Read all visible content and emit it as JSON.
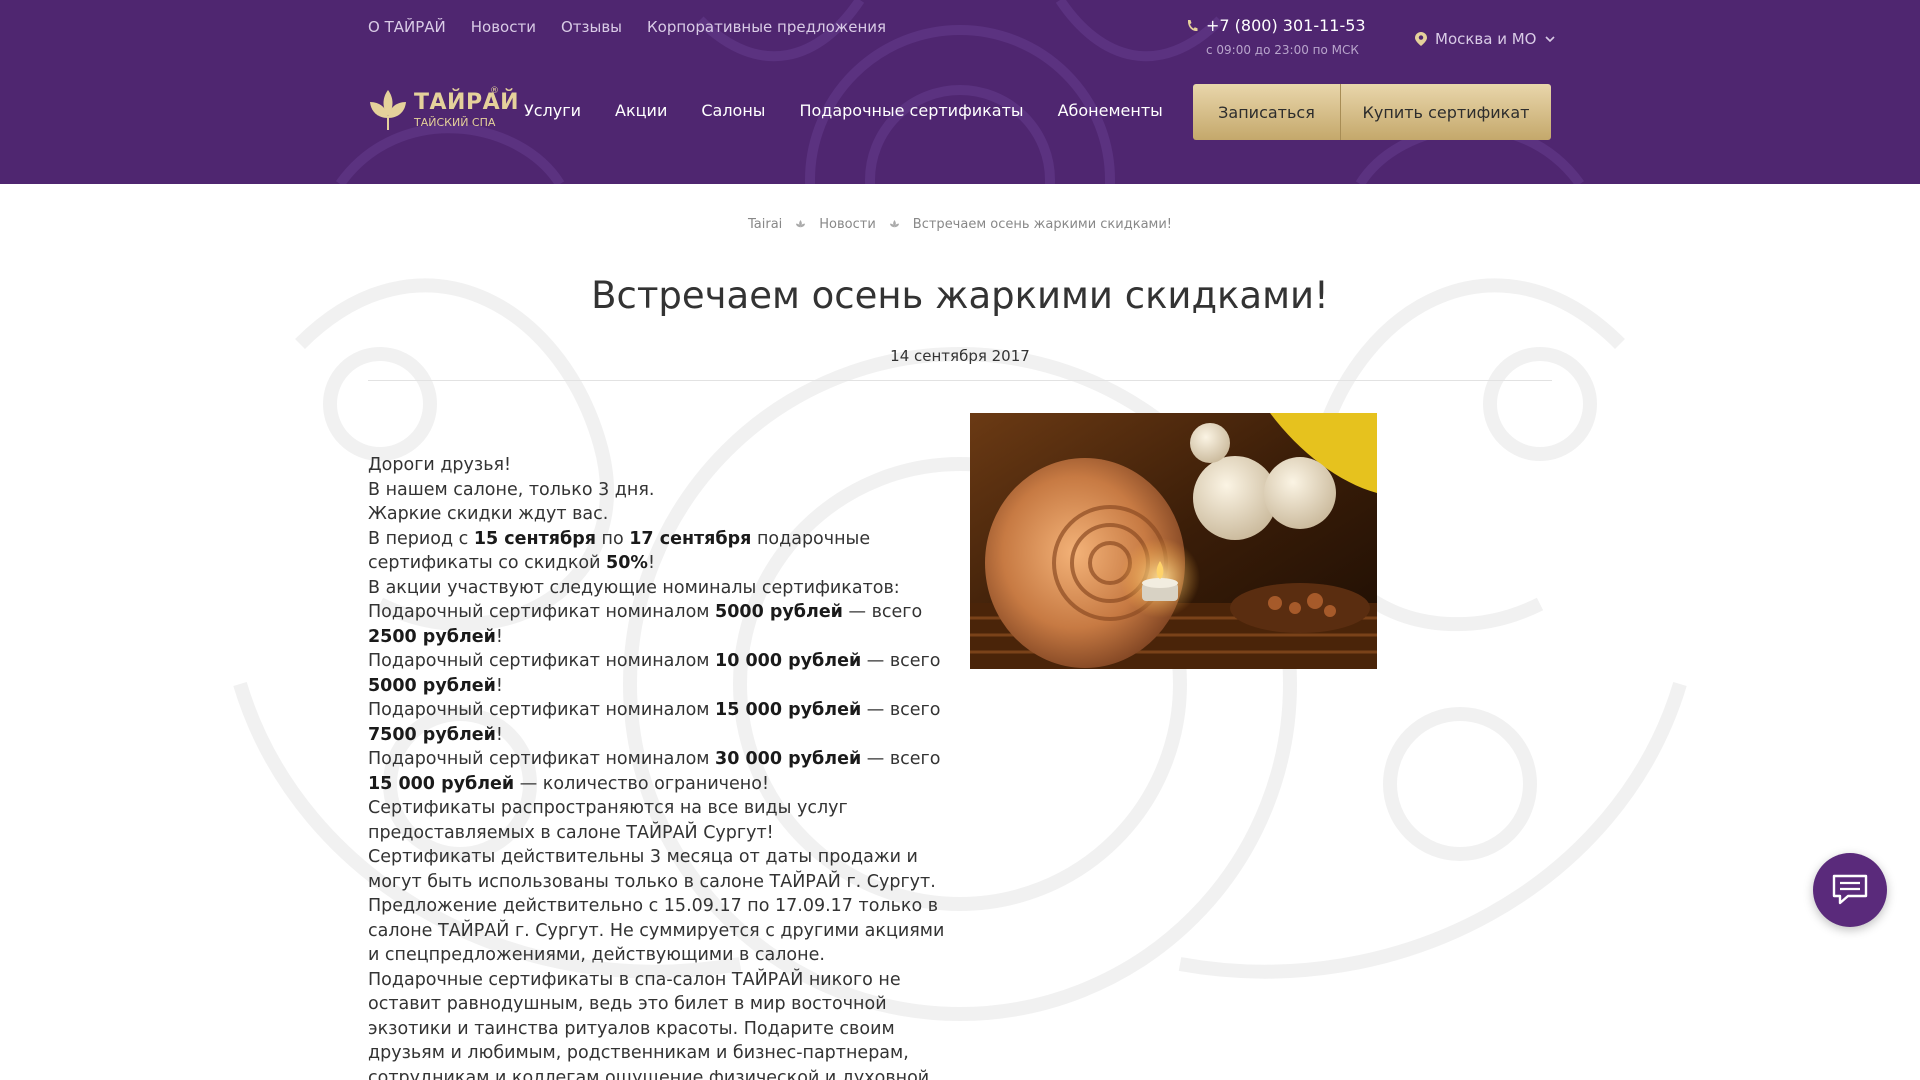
{
  "header": {
    "top_links": [
      "О ТАЙРАЙ",
      "Новости",
      "Отзывы",
      "Корпоративные предложения"
    ],
    "phone": "+7 (800) 301-11-53",
    "hours": "с 09:00 до 23:00 по МСК",
    "city": "Москва и МО",
    "logo_name": "ТАЙРАЙ",
    "logo_sub": "ТАЙСКИЙ СПА",
    "logo_reg": "®",
    "nav": [
      "Услуги",
      "Акции",
      "Салоны",
      "Подарочные сертификаты",
      "Абонементы"
    ],
    "btn_book": "Записаться",
    "btn_buy": "Купить сертификат"
  },
  "breadcrumb": [
    "Tairai",
    "Новости",
    "Встречаем осень жаркими скидками!"
  ],
  "title": "Встречаем осень жаркими скидками!",
  "date": "14 сентября 2017",
  "article": {
    "l1": "Дороги друзья!",
    "l2": "В нашем салоне, только 3 дня.",
    "l3": "Жаркие скидки ждут вас.",
    "p4a": "В период с ",
    "p4b": "15 сентября",
    "p4c": " по ",
    "p4d": "17 сентября",
    "p4e": " подарочные сертификаты со скидкой ",
    "p4f": "50%",
    "p4g": "!",
    "l5": "В акции участвуют следующие номиналы сертификатов:",
    "cert_prefix": "Подарочный сертификат номиналом ",
    "cert_mid": " — всего ",
    "certs": [
      {
        "nominal": "5000 рублей",
        "price": "2500 рублей",
        "suffix": "!"
      },
      {
        "nominal": "10 000 рублей",
        "price": "5000 рублей",
        "suffix": "!"
      },
      {
        "nominal": "15 000 рублей",
        "price": "7500 рублей",
        "suffix": "!"
      },
      {
        "nominal": "30 000 рублей",
        "price": "15 000 рублей",
        "suffix": " — количество ограничено!"
      }
    ],
    "l6": "Сертификаты распространяются на все виды услуг предоставляемых в салоне ТАЙРАЙ Сургут!",
    "l7": "Сертификаты действительны 3 месяца от даты продажи и могут быть использованы только в салоне ТАЙРАЙ г. Сургут.",
    "l8": "Предложение действительно с 15.09.17 по 17.09.17 только в салоне ТАЙРАЙ г. Сургут. Не суммируется с другими акциями и спецпредложениями, действующими в салоне.",
    "l9": "Подарочные сертификаты в спа-салон ТАЙРАЙ никого не оставит равнодушным, ведь это билет в мир восточной экзотики и таинства ритуалов красоты. Подарите своим друзьям и любимым, родственникам и бизнес-партнерам, сотрудникам и коллегам ощущение физической и духовной гармонии. Будьте уверены"
  },
  "colors": {
    "header_bg": "#4f2670",
    "gold": "#e5d19b",
    "button_gold": "#d9c08a",
    "chat_bg": "#5a2a7b"
  },
  "icons": {
    "phone": "phone-icon",
    "location": "location-pin-icon",
    "chevron": "chevron-down-icon",
    "crumb_separator": "leaf-separator-icon",
    "chat": "chat-icon",
    "logo": "lotus-logo-icon"
  }
}
